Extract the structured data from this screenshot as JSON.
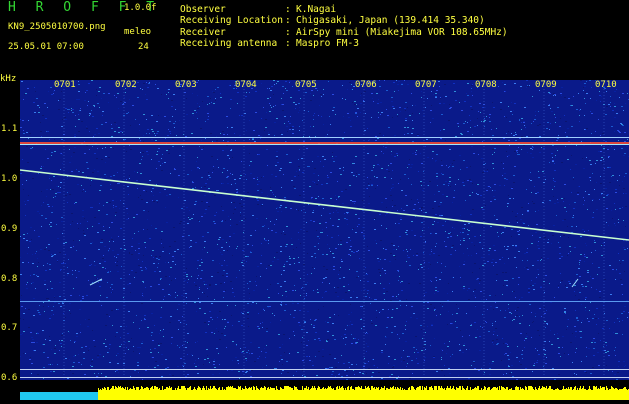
{
  "header": {
    "brand": "H R O F F T",
    "version": "1.0.0f",
    "filename": "KN9_2505010700.png",
    "datetime": "25.05.01 07:00",
    "meleo_label": "meleo",
    "count": "24",
    "fields": [
      {
        "label": "Observer",
        "value": "K.Nagai"
      },
      {
        "label": "Receiving Location",
        "value": "Chigasaki, Japan (139.414 35.340)"
      },
      {
        "label": "Receiver",
        "value": "AirSpy mini (Miakejima VOR 108.65MHz)"
      },
      {
        "label": "Receiving antenna",
        "value": "Maspro FM-3"
      }
    ]
  },
  "axes": {
    "y_unit": "kHz",
    "x_ticks": [
      "0701",
      "0702",
      "0703",
      "0704",
      "0705",
      "0706",
      "0707",
      "0708",
      "0709",
      "0710"
    ],
    "y_ticks": [
      "1.1",
      "1.0",
      "0.9",
      "0.8",
      "0.7",
      "0.6"
    ]
  },
  "colors": {
    "background_noise": "#0a1a8a",
    "text": "#ffff40",
    "brand": "#33d633",
    "signal": "#c8ffd0",
    "band": "#ff5030",
    "bottom_bar": "#ffff00",
    "bottom_bar_cyan": "#20c8f0"
  }
}
